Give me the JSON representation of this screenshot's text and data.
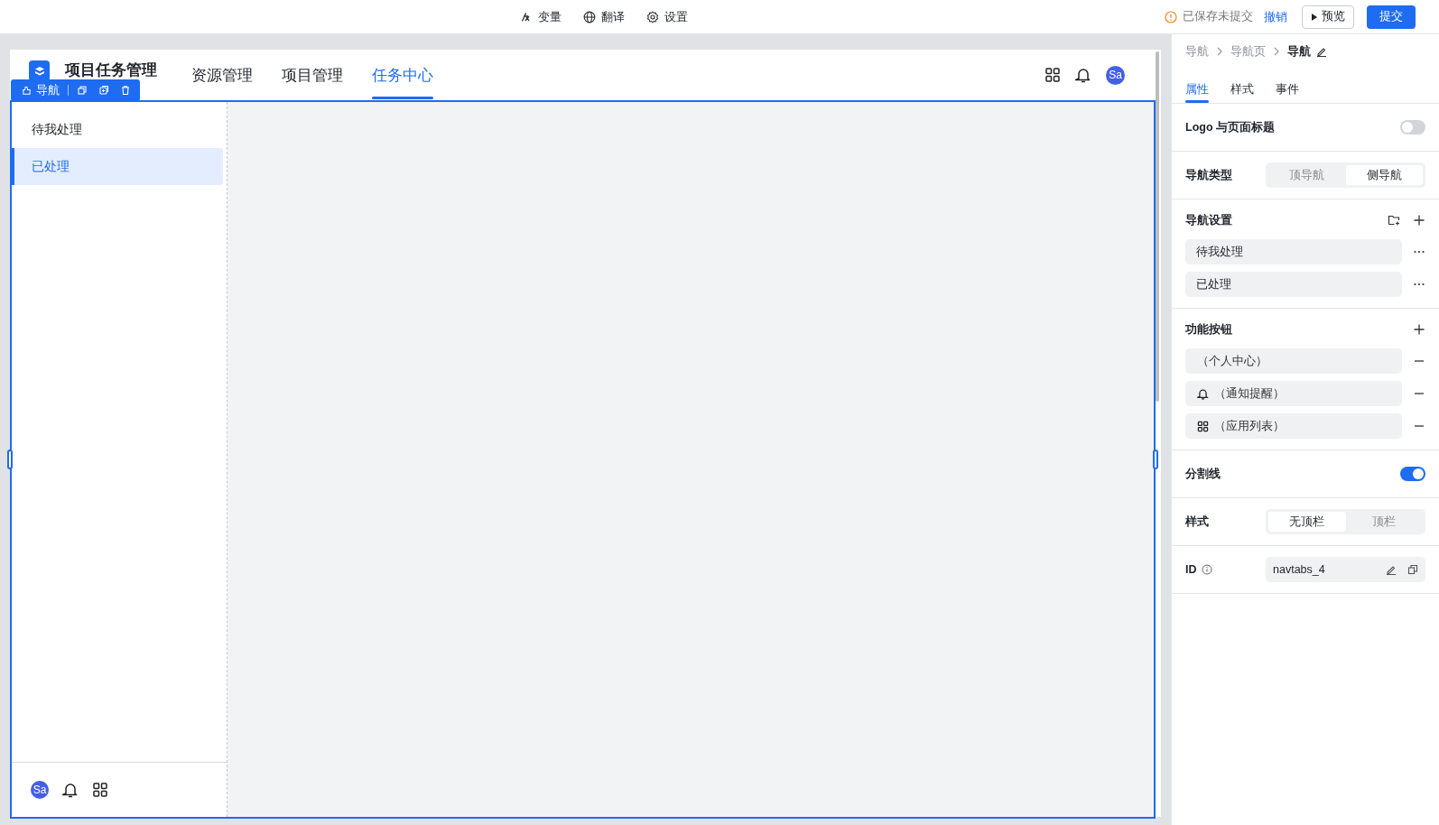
{
  "toolbar": {
    "items": [
      {
        "kind": "variable",
        "label": "变量"
      },
      {
        "kind": "globe",
        "label": "翻译"
      },
      {
        "kind": "gear",
        "label": "设置"
      }
    ],
    "status": "已保存未提交",
    "undo": "撤销",
    "preview": "预览",
    "submit": "提交"
  },
  "app": {
    "title": "项目任务管理",
    "tabs": [
      {
        "label": "资源管理",
        "selected": false
      },
      {
        "label": "项目管理",
        "selected": false
      },
      {
        "label": "任务中心",
        "selected": true
      }
    ],
    "avatar": "Sa"
  },
  "selection_toolbar": {
    "label": "导航"
  },
  "sidebar": {
    "items": [
      {
        "label": "待我处理",
        "selected": false
      },
      {
        "label": "已处理",
        "selected": true
      }
    ],
    "avatar": "Sa"
  },
  "panel": {
    "breadcrumb": [
      "导航",
      "导航页",
      "导航"
    ],
    "tabs": [
      {
        "label": "属性",
        "selected": true
      },
      {
        "label": "样式",
        "selected": false
      },
      {
        "label": "事件",
        "selected": false
      }
    ],
    "logo_title": {
      "label": "Logo 与页面标题",
      "on": false
    },
    "nav_type": {
      "label": "导航类型",
      "options": [
        {
          "label": "顶导航",
          "selected": false
        },
        {
          "label": "侧导航",
          "selected": true
        }
      ]
    },
    "nav_settings": {
      "label": "导航设置",
      "items": [
        "待我处理",
        "已处理"
      ]
    },
    "function_buttons": {
      "label": "功能按钮",
      "items": [
        {
          "kind": "none",
          "label": "（个人中心）"
        },
        {
          "kind": "bell",
          "label": "（通知提醒）"
        },
        {
          "kind": "grid",
          "label": "（应用列表）"
        }
      ]
    },
    "divider": {
      "label": "分割线",
      "on": true
    },
    "style": {
      "label": "样式",
      "options": [
        {
          "label": "无顶栏",
          "selected": true
        },
        {
          "label": "顶栏",
          "selected": false
        }
      ]
    },
    "id": {
      "label": "ID",
      "value": "navtabs_4"
    }
  }
}
